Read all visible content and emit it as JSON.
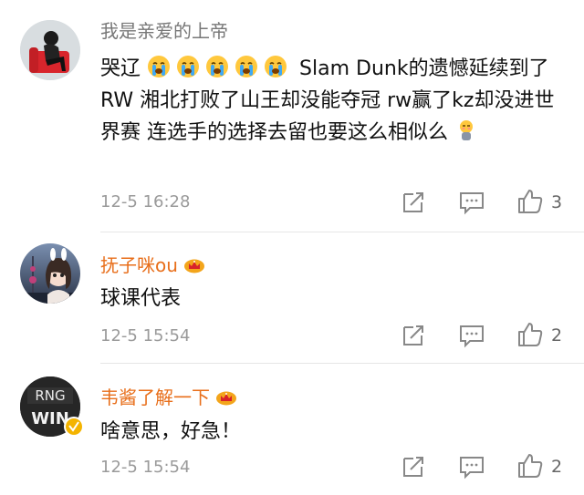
{
  "comments": [
    {
      "username": "我是亲爱的上帝",
      "text_part1": "哭辽",
      "text_part2": " Slam Dunk的遗憾延续到了RW 湘北打败了山王却没能夺冠 rw赢了kz却没进世界赛 连选手的选择去留也要这么相似么",
      "time": "12-5 16:28",
      "likes": "3"
    },
    {
      "username": "抚子咪ou",
      "text": "球课代表",
      "time": "12-5 15:54",
      "likes": "2"
    },
    {
      "username": "韦酱了解一下",
      "avatar_text_top": "RNG",
      "avatar_text_bottom": "WIN",
      "text": "啥意思，好急！",
      "time": "12-5 15:54",
      "likes": "2"
    }
  ],
  "colors": {
    "username_gray": "#777777",
    "username_orange": "#e86e1a",
    "time": "#9a9a9a",
    "icon": "#888888",
    "crown": "#f3a51b",
    "verified": "#f4b400"
  },
  "icons": [
    "crying-emoji",
    "crown-icon",
    "verified-badge-icon",
    "share-icon",
    "comment-icon",
    "thumbs-up-icon",
    "shy-emoji"
  ]
}
